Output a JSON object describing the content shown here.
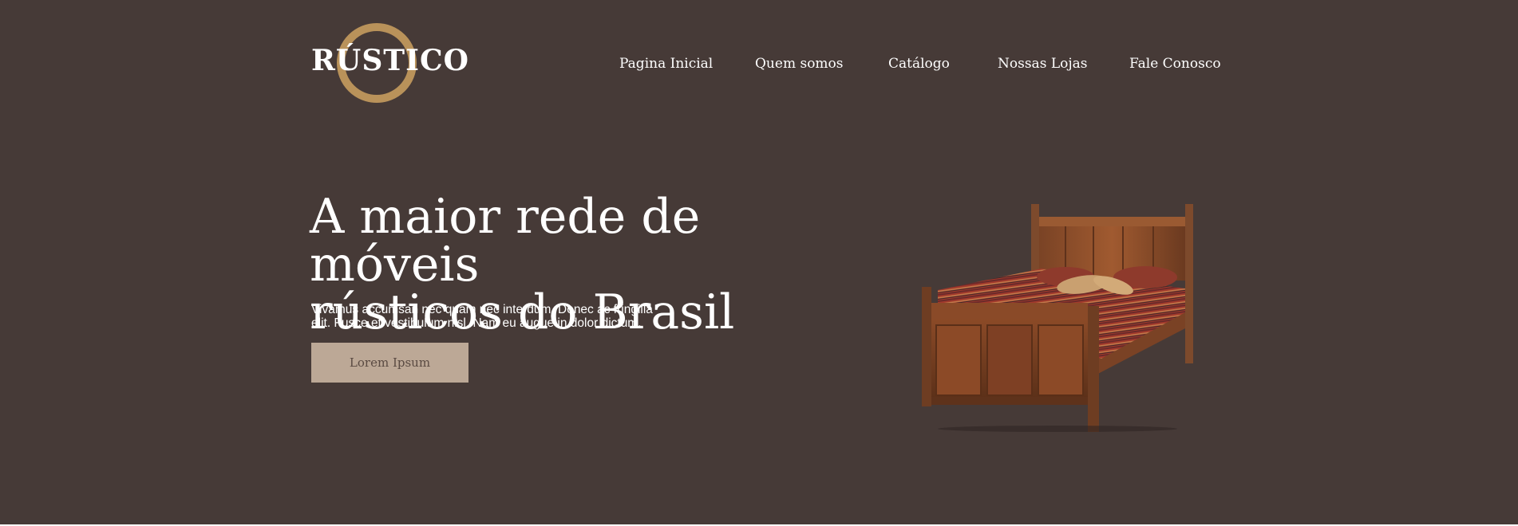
{
  "brand": {
    "logo_text": "RÚSTICO",
    "ring_color": "#b9925a"
  },
  "nav": {
    "items": [
      {
        "label": "Pagina Inicial"
      },
      {
        "label": "Quem somos"
      },
      {
        "label": "Catálogo"
      },
      {
        "label": "Nossas Lojas"
      },
      {
        "label": "Fale Conosco"
      }
    ]
  },
  "hero": {
    "headline_line1": "A maior rede de móveis",
    "headline_line2": "rústicos do Brasil",
    "subtext_line1": "Vivamus accumsan nec quam nec interdum. Donec ac fringilla",
    "subtext_line2": "elit. Fusce et vestibulum nisl. Nam eu augue in dolor dictum.",
    "cta_label": "Lorem Ipsum",
    "image_icon": "bed-icon"
  },
  "colors": {
    "background": "#463a37",
    "accent": "#b9925a",
    "button": "#bca896",
    "button_text": "#5a4a42",
    "text": "#ffffff"
  }
}
